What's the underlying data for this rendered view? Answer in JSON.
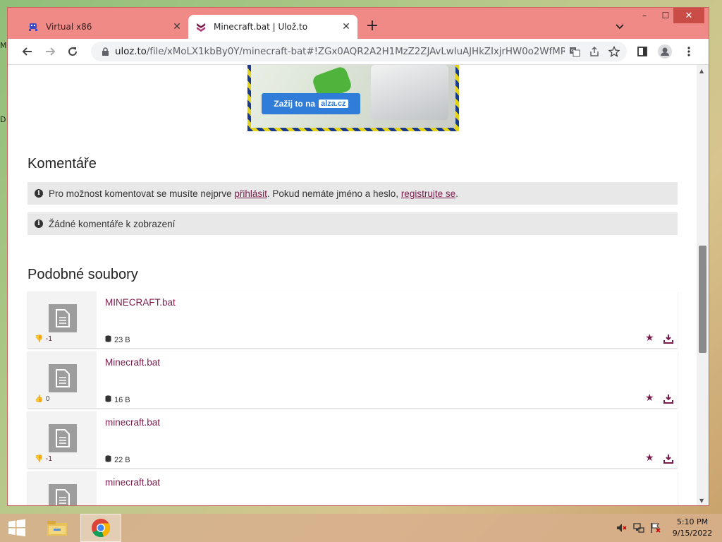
{
  "desktop": {
    "left_glyph_1": "M",
    "left_glyph_2": "D"
  },
  "browser": {
    "tabs": [
      {
        "title": "Virtual x86",
        "favicon": "space-invader-icon",
        "active": false
      },
      {
        "title": "Minecraft.bat | Ulož.to",
        "favicon": "uloz-to-logo-icon",
        "active": true
      }
    ],
    "new_tab_label": "+",
    "window_controls": {
      "minimize": "–",
      "maximize": "☐",
      "close": "✕"
    },
    "url_host": "uloz.to",
    "url_path": "/file/xMoLX1kbBy0Y/minecraft-bat#!ZGx0AQR2A2H1MzZ2ZJAvLwIuAJHkZIxjrHW0o2WfMRA..."
  },
  "ad": {
    "button_text": "Zažij to na",
    "logo_text": "alza.cz"
  },
  "comments": {
    "heading": "Komentáře",
    "login_notice": {
      "text_before": "Pro možnost komentovat se musíte nejprve",
      "login_link": "přihlásit",
      "text_middle": ". Pokud nemáte jméno a heslo,",
      "register_link": "registrujte se",
      "text_after": "."
    },
    "empty_notice": "Žádné komentáře k zobrazení"
  },
  "similar": {
    "heading": "Podobné soubory",
    "files": [
      {
        "name": "MINECRAFT.bat",
        "rating": "-1",
        "rating_type": "negative",
        "size": "23 B"
      },
      {
        "name": "Minecraft.bat",
        "rating": "0",
        "rating_type": "positive",
        "size": "16 B"
      },
      {
        "name": "minecraft.bat",
        "rating": "-1",
        "rating_type": "negative",
        "size": "22 B"
      },
      {
        "name": "minecraft.bat",
        "rating": "",
        "rating_type": "",
        "size": ""
      }
    ]
  },
  "taskbar": {
    "time": "5:10 PM",
    "date": "9/15/2022"
  },
  "colors": {
    "accent": "#7a1d4c",
    "tabstrip": "#f08a86",
    "window_close": "#c94c47",
    "ad_button": "#2f7dd8"
  }
}
